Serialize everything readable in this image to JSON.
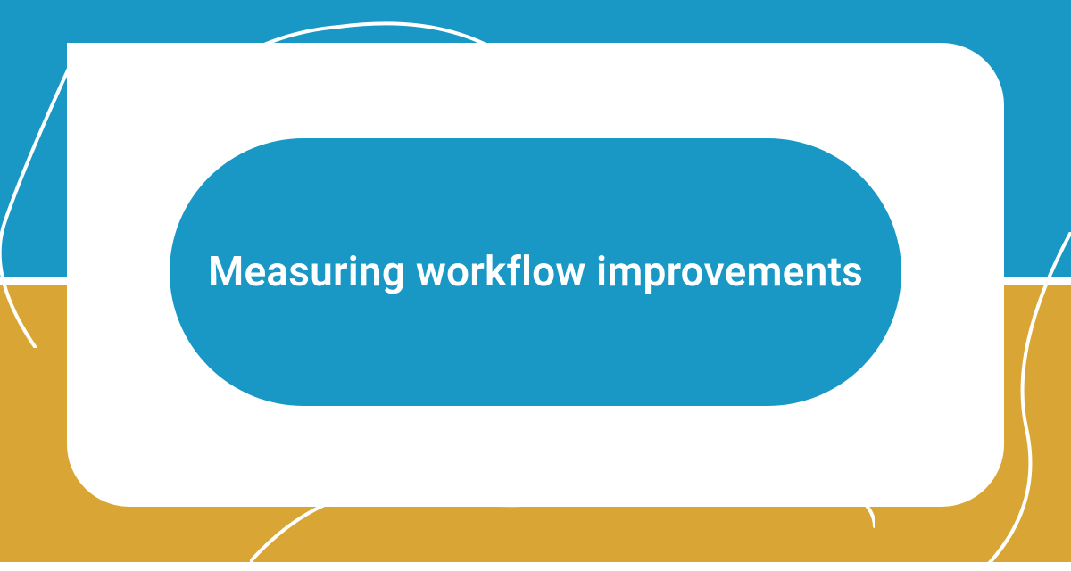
{
  "title": "Measuring workflow improvements",
  "colors": {
    "teal": "#1998c5",
    "gold": "#d9a636",
    "white": "#ffffff"
  }
}
